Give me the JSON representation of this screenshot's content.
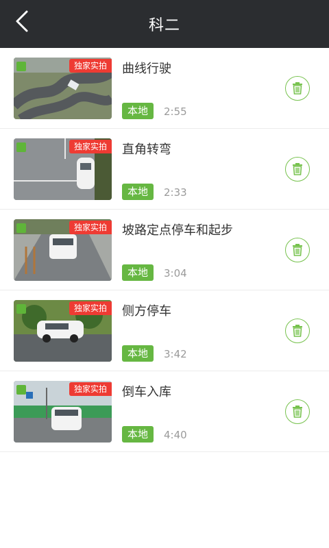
{
  "header": {
    "title": "科二",
    "back_icon": "chevron-left-icon"
  },
  "colors": {
    "header_bg": "#2b2d30",
    "accent_green": "#66b742",
    "badge_red": "#ee3b33"
  },
  "items": [
    {
      "title": "曲线行驶",
      "badge": "独家实拍",
      "tag": "本地",
      "duration": "2:55",
      "delete_icon": "trash-icon"
    },
    {
      "title": "直角转弯",
      "badge": "独家实拍",
      "tag": "本地",
      "duration": "2:33",
      "delete_icon": "trash-icon"
    },
    {
      "title": "坡路定点停车和起步",
      "badge": "独家实拍",
      "tag": "本地",
      "duration": "3:04",
      "delete_icon": "trash-icon"
    },
    {
      "title": "侧方停车",
      "badge": "独家实拍",
      "tag": "本地",
      "duration": "3:42",
      "delete_icon": "trash-icon"
    },
    {
      "title": "倒车入库",
      "badge": "独家实拍",
      "tag": "本地",
      "duration": "4:40",
      "delete_icon": "trash-icon"
    }
  ]
}
